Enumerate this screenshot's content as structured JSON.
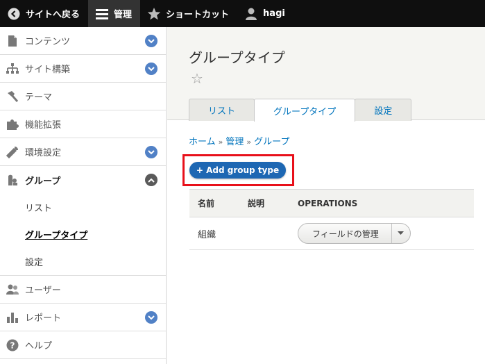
{
  "toolbar": {
    "back_label": "サイトへ戻る",
    "manage_label": "管理",
    "shortcut_label": "ショートカット",
    "user_label": "hagi"
  },
  "sidebar": {
    "items": [
      {
        "label": "コンテンツ",
        "icon": "file-icon"
      },
      {
        "label": "サイト構築",
        "icon": "sitemap-icon"
      },
      {
        "label": "テーマ",
        "icon": "brush-icon"
      },
      {
        "label": "機能拡張",
        "icon": "puzzle-icon"
      },
      {
        "label": "環境設定",
        "icon": "wrench-icon"
      },
      {
        "label": "グループ",
        "icon": "group-icon"
      },
      {
        "label": "ユーザー",
        "icon": "users-icon"
      },
      {
        "label": "レポート",
        "icon": "bar-chart-icon"
      },
      {
        "label": "ヘルプ",
        "icon": "help-icon"
      }
    ],
    "group_sub": [
      "リスト",
      "グループタイプ",
      "設定"
    ]
  },
  "page": {
    "title": "グループタイプ",
    "tabs": [
      "リスト",
      "グループタイプ",
      "設定"
    ],
    "breadcrumb": [
      "ホーム",
      "管理",
      "グループ"
    ],
    "breadcrumb_sep": "»",
    "add_button": "+ Add group type"
  },
  "table": {
    "headers": [
      "名前",
      "説明",
      "OPERATIONS"
    ],
    "rows": [
      {
        "name": "組織",
        "description": "",
        "operation": "フィールドの管理"
      }
    ]
  },
  "colors": {
    "accent": "#0074bd",
    "button": "#1d67b3",
    "highlight": "#e8101a",
    "chevron": "#5181c6"
  }
}
